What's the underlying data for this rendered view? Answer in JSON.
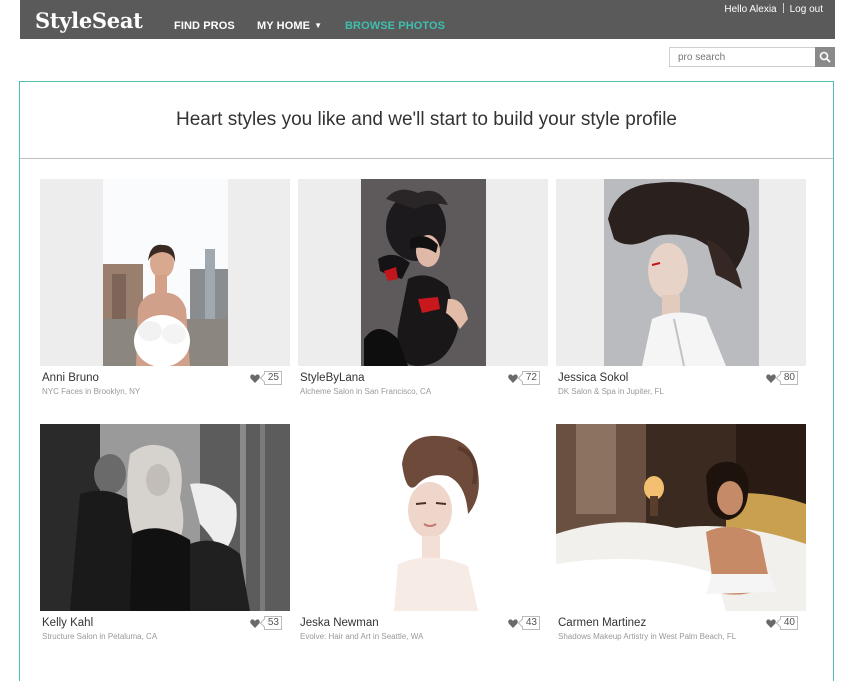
{
  "header": {
    "logo": "StyleSeat",
    "nav": [
      {
        "label": "FIND PROS"
      },
      {
        "label": "MY HOME"
      },
      {
        "label": "BROWSE PHOTOS"
      }
    ],
    "greeting": "Hello Alexia",
    "logout": "Log out"
  },
  "search": {
    "placeholder": "pro search"
  },
  "headline": "Heart styles you like and we'll start to build your style profile",
  "cards": [
    {
      "name": "Anni Bruno",
      "location": "NYC Faces in Brooklyn, NY",
      "likes": "25"
    },
    {
      "name": "StyleByLana",
      "location": "Alcheme Salon in San Francisco, CA",
      "likes": "72"
    },
    {
      "name": "Jessica Sokol",
      "location": "DK Salon & Spa in Jupiter, FL",
      "likes": "80"
    },
    {
      "name": "Kelly Kahl",
      "location": "Structure Salon in Petaluma, CA",
      "likes": "53"
    },
    {
      "name": "Jeska Newman",
      "location": "Evolve: Hair and Art in Seattle, WA",
      "likes": "43"
    },
    {
      "name": "Carmen Martinez",
      "location": "Shadows Makeup Artistry in West Palm Beach, FL",
      "likes": "40"
    }
  ],
  "icons": {
    "search": "search-icon",
    "heart": "heart-icon",
    "caret": "chevron-down-icon"
  },
  "colors": {
    "topbar": "#5a5a5a",
    "accent": "#3fbfae",
    "panel_border": "#4fbfb0"
  }
}
